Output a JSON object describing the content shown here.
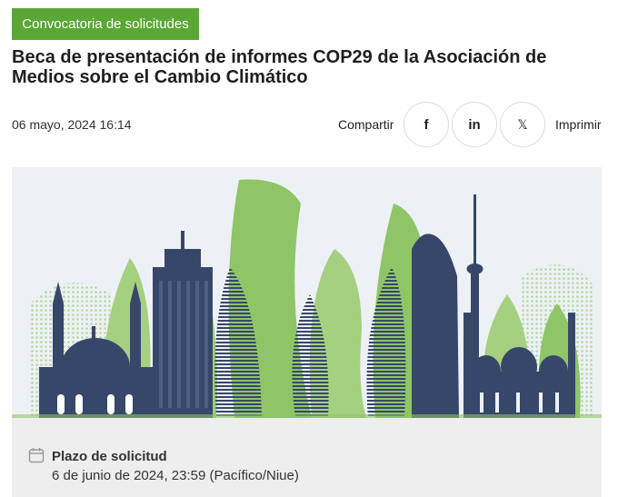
{
  "badge": {
    "label": "Convocatoria de solicitudes",
    "color": "#5aa736"
  },
  "article": {
    "title": "Beca de presentación de informes COP29 de la Asociación de Medios sobre el Cambio Climático",
    "date": "06 mayo, 2024 16:14"
  },
  "share": {
    "label": "Compartir",
    "facebook": "f",
    "linkedin": "in",
    "x": "𝕏",
    "print": "Imprimir"
  },
  "deadline": {
    "label": "Plazo de solicitud",
    "value": "6 de junio de 2024, 23:59 (Pacífico/Niue)"
  },
  "icons": [
    "calendar-icon",
    "facebook-icon",
    "linkedin-icon",
    "x-icon"
  ],
  "colors": {
    "accent_green": "#5aa736",
    "skyline_navy": "#37476a",
    "skyline_green": "#8fc567"
  }
}
